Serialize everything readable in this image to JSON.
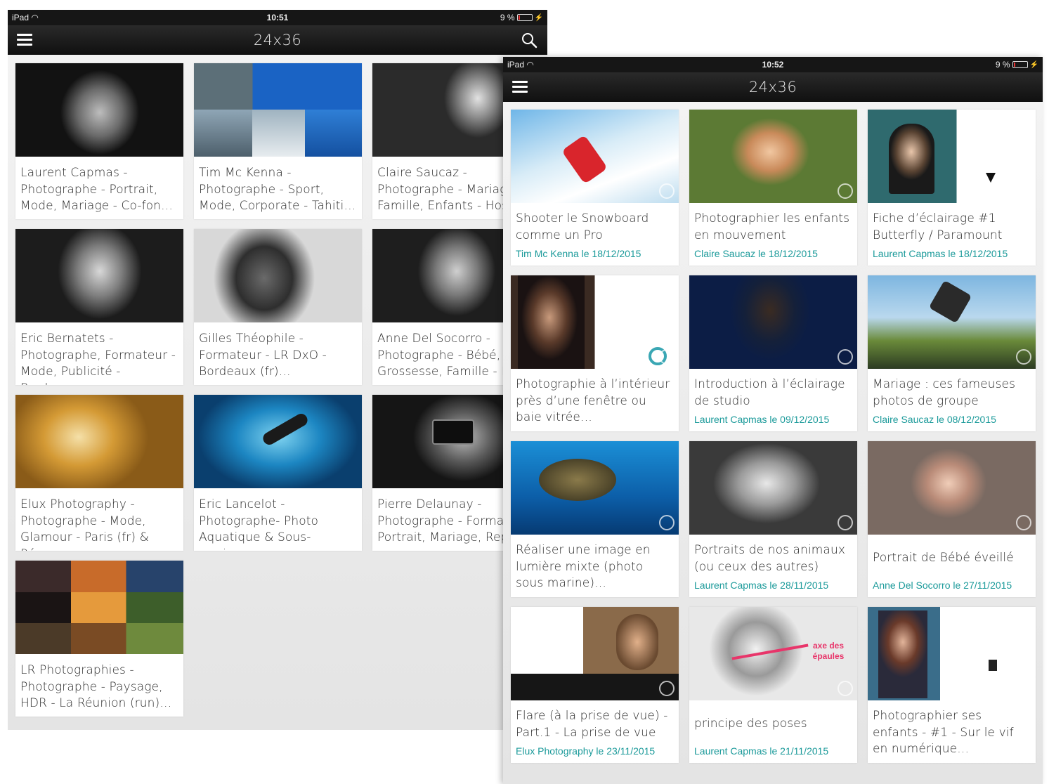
{
  "screen1": {
    "status": {
      "carrier": "iPad",
      "time": "10:51",
      "battery": "9 %"
    },
    "nav": {
      "title": "24x36"
    },
    "photographers": [
      {
        "name": "Laurent Capmas - Photographe - Portrait, Mode, Mariage - Co-fon…"
      },
      {
        "name": "Tim Mc Kenna - Photographe - Sport, Mode, Corporate - Tahiti…"
      },
      {
        "name": "Claire Saucaz - Photographe - Mariag Famille, Enfants - Hoss"
      },
      {
        "name": "Eric Bernatets - Photographe, Formateur - Mode, Publicité - Bordea…"
      },
      {
        "name": "Gilles Théophile - Formateur - LR DxO - Bordeaux (fr)…"
      },
      {
        "name": "Anne Del Socorro - Photographe - Bébé, Grossesse, Famille - M"
      },
      {
        "name": "Elux Photography - Photographe - Mode, Glamour - Paris (fr) & Ré…"
      },
      {
        "name": "Eric Lancelot - Photographe- Photo Aquatique & Sous-marin…"
      },
      {
        "name": "Pierre Delaunay - Photographe -  Format Portrait, Mariage, Rep"
      },
      {
        "name": "LR Photographies - Photographe - Paysage, HDR - La Réunion (run)…"
      }
    ]
  },
  "screen2": {
    "status": {
      "carrier": "iPad",
      "time": "10:52",
      "battery": "9 %"
    },
    "nav": {
      "title": "24x36"
    },
    "articles": [
      {
        "title": "Shooter le Snowboard comme un Pro",
        "meta": "Tim Mc Kenna le 18/12/2015"
      },
      {
        "title": "Photographier les enfants en mouvement",
        "meta": "Claire Saucaz le 18/12/2015"
      },
      {
        "title": "Fiche d’éclairage #1 Butterfly / Paramount",
        "meta": "Laurent Capmas le 18/12/2015"
      },
      {
        "title": "Photographie à l’intérieur près d’une fenêtre ou baie vitrée…",
        "meta": ""
      },
      {
        "title": "Introduction à l’éclairage de studio",
        "meta": "Laurent Capmas le 09/12/2015"
      },
      {
        "title": "Mariage : ces fameuses photos de groupe",
        "meta": "Claire Saucaz le 08/12/2015"
      },
      {
        "title": "Réaliser une image en lumière mixte (photo sous marine)…",
        "meta": ""
      },
      {
        "title": "Portraits de nos animaux (ou ceux des autres)",
        "meta": "Laurent Capmas le 28/11/2015"
      },
      {
        "title": "Portrait de Bébé éveillé",
        "meta": "Anne Del Socorro le 27/11/2015"
      },
      {
        "title": "Flare (à la prise  de vue) - Part.1 - La prise de vue",
        "meta": "Elux Photography le 23/11/2015"
      },
      {
        "title": "principe des poses",
        "meta": "Laurent Capmas le 21/11/2015",
        "overlay": "axe des épaules"
      },
      {
        "title": "Photographier ses enfants - #1 - Sur le vif en numérique…",
        "meta": ""
      }
    ]
  },
  "colors": {
    "accent": "#1b9a9a",
    "navbar": "#1a1a1a",
    "background": "#ececec"
  },
  "icons": {
    "menu": "hamburger-icon",
    "search": "search-icon",
    "wifi": "wifi-icon",
    "battery": "battery-icon"
  }
}
